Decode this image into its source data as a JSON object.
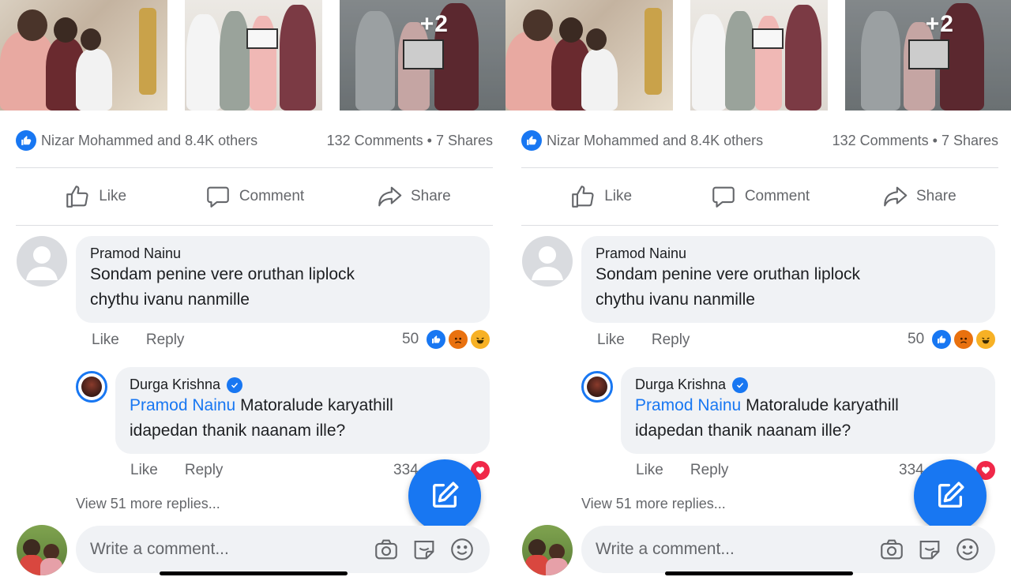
{
  "photos": {
    "overflow_label": "+2"
  },
  "post": {
    "likes_text": "Nizar Mohammed and 8.4K others",
    "comments_shares_text": "132 Comments • 7 Shares"
  },
  "actions": [
    {
      "label": "Like",
      "icon": "thumbs-up-icon"
    },
    {
      "label": "Comment",
      "icon": "comment-icon"
    },
    {
      "label": "Share",
      "icon": "share-icon"
    }
  ],
  "comment": {
    "author": "Pramod Nainu",
    "text_line1": "Sondam penine vere oruthan liplock",
    "text_line2": "chythu ivanu nanmille",
    "like_label": "Like",
    "reply_label": "Reply",
    "reaction_count": "50"
  },
  "reply": {
    "author": "Durga Krishna",
    "mention": "Pramod Nainu",
    "text_line1": " Matoralude karyathill",
    "text_line2": "idapedan thanik naanam ille?",
    "like_label": "Like",
    "reply_label": "Reply",
    "reaction_count": "334"
  },
  "view_more": "View 51 more replies...",
  "composer": {
    "placeholder": "Write a comment..."
  },
  "colors": {
    "accent": "#1877f2",
    "bubble": "#f0f2f5",
    "muted": "#65676b"
  }
}
